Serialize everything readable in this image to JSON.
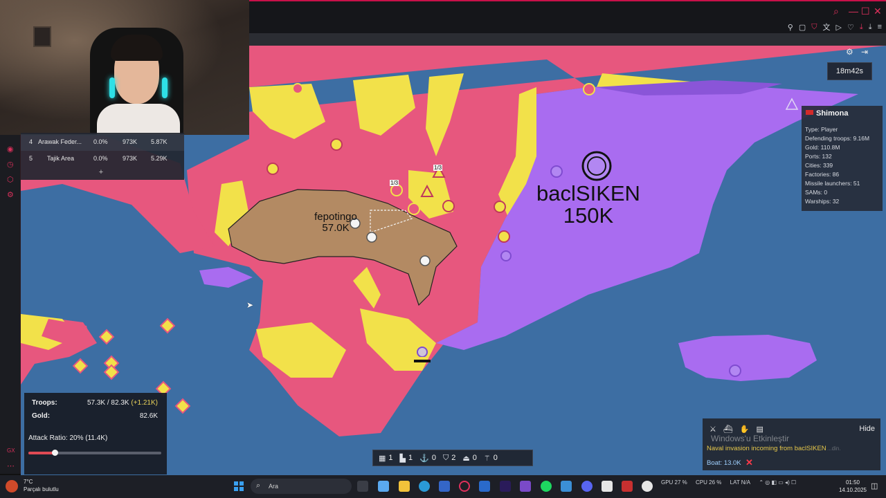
{
  "browser": {
    "toolbar_icons": [
      "pin-icon",
      "bookmark-icon",
      "shield-icon",
      "translate-icon",
      "play-icon",
      "heart-icon",
      "download-icon",
      "menu-icon"
    ]
  },
  "leaderboard": {
    "rows": [
      {
        "rank": "4",
        "name": "Arawak Feder...",
        "pct": "0.0%",
        "gold": "973K",
        "troops": "5.87K"
      },
      {
        "rank": "5",
        "name": "Tajik Area",
        "pct": "0.0%",
        "gold": "973K",
        "troops": "5.29K"
      }
    ],
    "expand_label": "+"
  },
  "timer": {
    "value": "18m42s"
  },
  "player": {
    "name": "Shimona",
    "stats": [
      "Type: Player",
      "Defending troops: 9.16M",
      "Gold: 110.8M",
      "Ports: 132",
      "Cities: 339",
      "Factories: 86",
      "Missile launchers: 51",
      "SAMs: 0",
      "Warships: 32"
    ]
  },
  "map_labels": {
    "enemy": {
      "name": "baclSIKEN",
      "troops": "150K"
    },
    "self": {
      "name": "fepotingo",
      "troops": "57.0K"
    },
    "marker_1": "1/3",
    "marker_2": "1/3"
  },
  "stats_panel": {
    "troops_label": "Troops:",
    "troops_value": "57.3K / 82.3K",
    "troops_gain": "(+1.21K)",
    "gold_label": "Gold:",
    "gold_value": "82.6K",
    "attack_ratio_label": "Attack Ratio: 20% (11.4K)",
    "attack_ratio": 0.2
  },
  "build_bar": {
    "items": [
      {
        "icon": "city-icon",
        "count": "1"
      },
      {
        "icon": "factory-icon",
        "count": "1"
      },
      {
        "icon": "port-icon",
        "count": "0"
      },
      {
        "icon": "defense-icon",
        "count": "2"
      },
      {
        "icon": "missile-silo-icon",
        "count": "0"
      },
      {
        "icon": "sam-icon",
        "count": "0"
      }
    ]
  },
  "events": {
    "hide_label": "Hide",
    "watermark": "Windows'u Etkinleştir",
    "watermark_sub": "...din.",
    "naval_message": "Naval invasion incoming from baclSIKEN",
    "boat_message": "Boat: 13.0K",
    "close_symbol": "✕"
  },
  "taskbar": {
    "temperature": "7°C",
    "weather": "Parçalı bulutlu",
    "search_placeholder": "Ara",
    "tray": [
      "GPU 27 %",
      "CPU 26 %",
      "LAT N/A"
    ],
    "time": "01:50",
    "date": "14.10.2025"
  },
  "colors": {
    "ocean": "#3d6ea3",
    "player_pink": "#e7577e",
    "player_yellow": "#f2e14a",
    "enemy_purple": "#a96cf0",
    "self_tan": "#b38a63",
    "accent_red": "#e0305c"
  }
}
